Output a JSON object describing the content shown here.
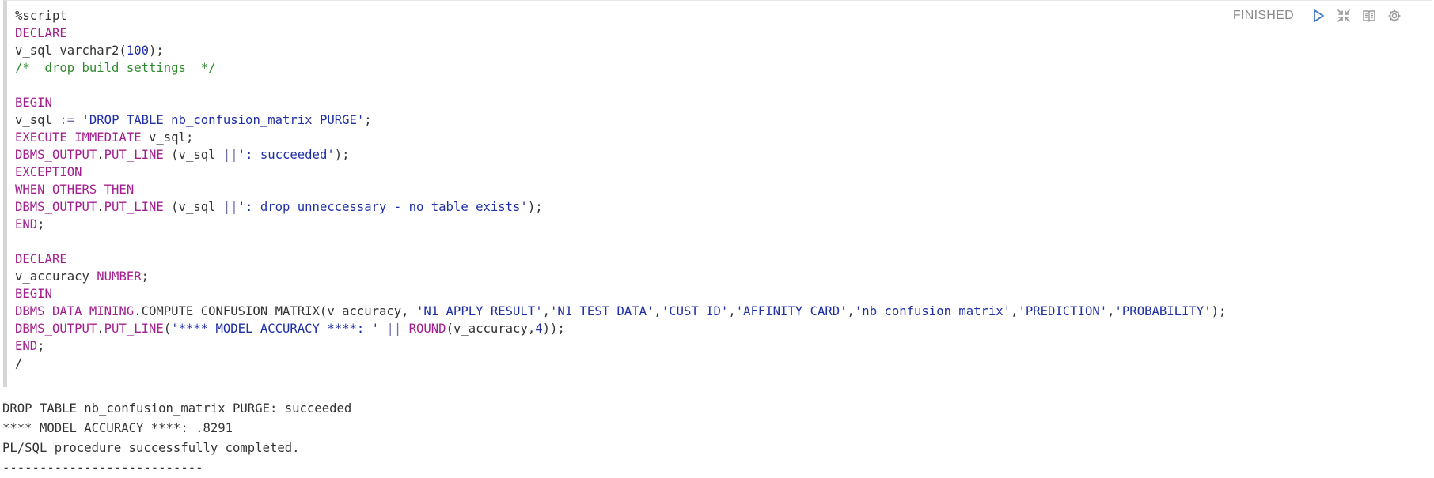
{
  "toolbar": {
    "status": "FINISHED",
    "icons": [
      "run-icon",
      "collapse-icon",
      "book-icon",
      "settings-icon"
    ]
  },
  "code_lines": [
    [
      {
        "t": "%script",
        "c": "plain"
      }
    ],
    [
      {
        "t": "DECLARE",
        "c": "kw"
      }
    ],
    [
      {
        "t": "v_sql varchar2(",
        "c": "plain"
      },
      {
        "t": "100",
        "c": "num"
      },
      {
        "t": ");",
        "c": "plain"
      }
    ],
    [
      {
        "t": "/*  drop build settings  */",
        "c": "cmt"
      }
    ],
    [],
    [
      {
        "t": "BEGIN",
        "c": "kw"
      }
    ],
    [
      {
        "t": "v_sql ",
        "c": "plain"
      },
      {
        "t": ":=",
        "c": "op"
      },
      {
        "t": " ",
        "c": "plain"
      },
      {
        "t": "'DROP TABLE nb_confusion_matrix PURGE'",
        "c": "str"
      },
      {
        "t": ";",
        "c": "plain"
      }
    ],
    [
      {
        "t": "EXECUTE IMMEDIATE",
        "c": "kw"
      },
      {
        "t": " v_sql;",
        "c": "plain"
      }
    ],
    [
      {
        "t": "DBMS_OUTPUT",
        "c": "kw"
      },
      {
        "t": ".",
        "c": "plain"
      },
      {
        "t": "PUT_LINE",
        "c": "kw"
      },
      {
        "t": " (v_sql ",
        "c": "plain"
      },
      {
        "t": "||",
        "c": "op"
      },
      {
        "t": "': succeeded'",
        "c": "str"
      },
      {
        "t": ");",
        "c": "plain"
      }
    ],
    [
      {
        "t": "EXCEPTION",
        "c": "kw"
      }
    ],
    [
      {
        "t": "WHEN OTHERS THEN",
        "c": "kw"
      }
    ],
    [
      {
        "t": "DBMS_OUTPUT",
        "c": "kw"
      },
      {
        "t": ".",
        "c": "plain"
      },
      {
        "t": "PUT_LINE",
        "c": "kw"
      },
      {
        "t": " (v_sql ",
        "c": "plain"
      },
      {
        "t": "||",
        "c": "op"
      },
      {
        "t": "': drop unneccessary - no table exists'",
        "c": "str"
      },
      {
        "t": ");",
        "c": "plain"
      }
    ],
    [
      {
        "t": "END",
        "c": "kw"
      },
      {
        "t": ";",
        "c": "plain"
      }
    ],
    [],
    [
      {
        "t": "DECLARE",
        "c": "kw"
      }
    ],
    [
      {
        "t": "v_accuracy ",
        "c": "plain"
      },
      {
        "t": "NUMBER",
        "c": "kw"
      },
      {
        "t": ";",
        "c": "plain"
      }
    ],
    [
      {
        "t": "BEGIN",
        "c": "kw"
      }
    ],
    [
      {
        "t": "DBMS_DATA_MINING",
        "c": "kw"
      },
      {
        "t": ".COMPUTE_CONFUSION_MATRIX(v_accuracy, ",
        "c": "plain"
      },
      {
        "t": "'N1_APPLY_RESULT'",
        "c": "str"
      },
      {
        "t": ",",
        "c": "plain"
      },
      {
        "t": "'N1_TEST_DATA'",
        "c": "str"
      },
      {
        "t": ",",
        "c": "plain"
      },
      {
        "t": "'CUST_ID'",
        "c": "str"
      },
      {
        "t": ",",
        "c": "plain"
      },
      {
        "t": "'AFFINITY_CARD'",
        "c": "str"
      },
      {
        "t": ",",
        "c": "plain"
      },
      {
        "t": "'nb_confusion_matrix'",
        "c": "str"
      },
      {
        "t": ",",
        "c": "plain"
      },
      {
        "t": "'PREDICTION'",
        "c": "str"
      },
      {
        "t": ",",
        "c": "plain"
      },
      {
        "t": "'PROBABILITY'",
        "c": "str"
      },
      {
        "t": ");",
        "c": "plain"
      }
    ],
    [
      {
        "t": "DBMS_OUTPUT",
        "c": "kw"
      },
      {
        "t": ".",
        "c": "plain"
      },
      {
        "t": "PUT_LINE",
        "c": "kw"
      },
      {
        "t": "(",
        "c": "plain"
      },
      {
        "t": "'**** MODEL ACCURACY ****: '",
        "c": "str"
      },
      {
        "t": " ",
        "c": "plain"
      },
      {
        "t": "||",
        "c": "op"
      },
      {
        "t": " ",
        "c": "plain"
      },
      {
        "t": "ROUND",
        "c": "kw"
      },
      {
        "t": "(v_accuracy,",
        "c": "plain"
      },
      {
        "t": "4",
        "c": "num"
      },
      {
        "t": "));",
        "c": "plain"
      }
    ],
    [
      {
        "t": "END",
        "c": "kw"
      },
      {
        "t": ";",
        "c": "plain"
      }
    ],
    [
      {
        "t": "/",
        "c": "plain"
      }
    ]
  ],
  "output_lines": [
    "DROP TABLE nb_confusion_matrix PURGE: succeeded",
    "**** MODEL ACCURACY ****: .8291",
    "PL/SQL procedure successfully completed.",
    "---------------------------"
  ]
}
